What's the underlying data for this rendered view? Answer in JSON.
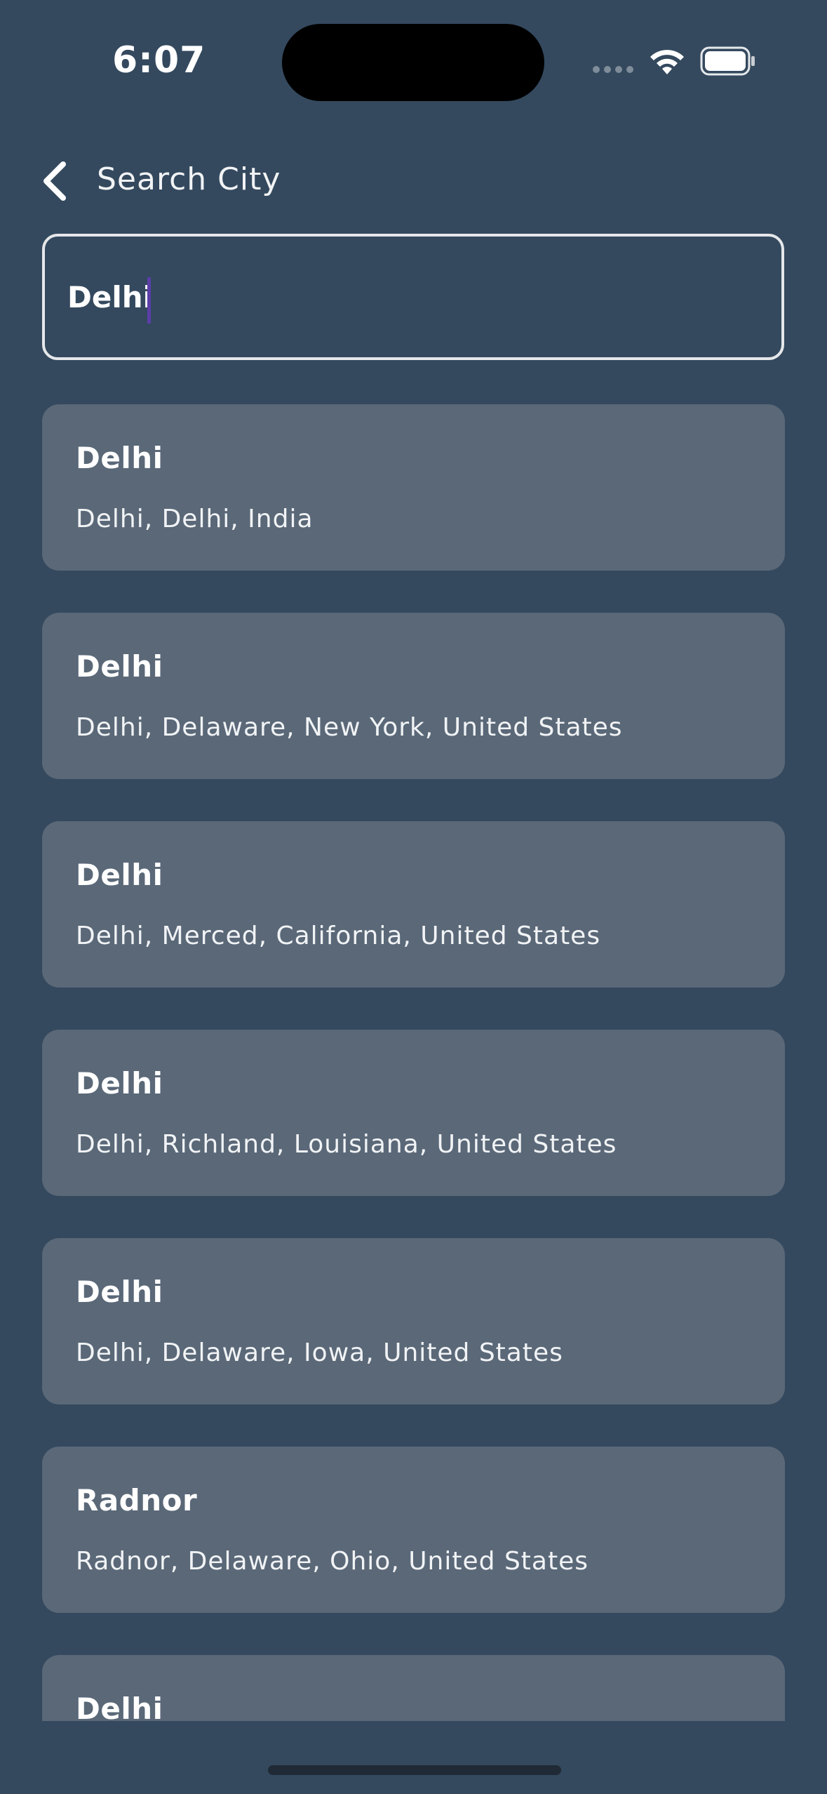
{
  "status_bar": {
    "time": "6:07",
    "icons": [
      "cellular-signal-icon",
      "wifi-icon",
      "battery-icon"
    ]
  },
  "nav": {
    "back_icon": "chevron-left-icon",
    "title": "Search City"
  },
  "search": {
    "value": "Delhi",
    "placeholder": ""
  },
  "results": [
    {
      "name": "Delhi",
      "detail": "Delhi,  Delhi,  India"
    },
    {
      "name": "Delhi",
      "detail": "Delhi,  Delaware,  New York,  United States"
    },
    {
      "name": "Delhi",
      "detail": "Delhi,  Merced,  California,  United States"
    },
    {
      "name": "Delhi",
      "detail": "Delhi,  Richland,  Louisiana,  United States"
    },
    {
      "name": "Delhi",
      "detail": "Delhi,  Delaware,  Iowa,  United States"
    },
    {
      "name": "Radnor",
      "detail": "Radnor,  Delaware,  Ohio,  United States"
    },
    {
      "name": "Delhi",
      "detail": ""
    }
  ],
  "colors": {
    "background": "#34495e",
    "card": "#5a6878",
    "input_border": "#e5e7ea",
    "caret": "#5b3ea8"
  }
}
